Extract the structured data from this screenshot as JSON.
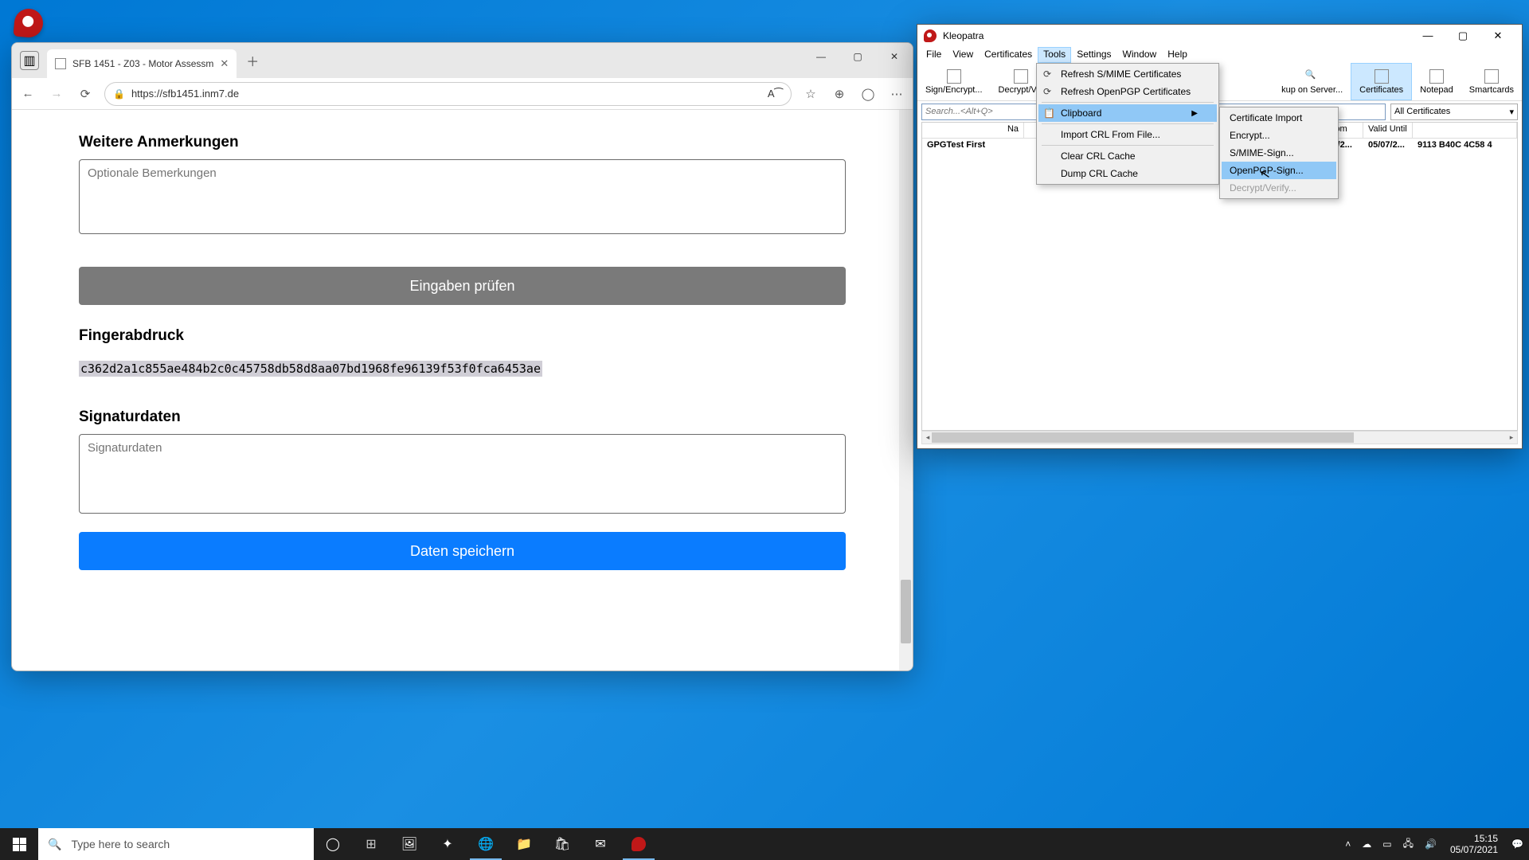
{
  "edge": {
    "tab_title": "SFB 1451 - Z03 - Motor Assessm",
    "url": "https://sfb1451.inm7.de",
    "page": {
      "remarks_heading": "Weitere Anmerkungen",
      "remarks_placeholder": "Optionale Bemerkungen",
      "check_button": "Eingaben prüfen",
      "fingerprint_heading": "Fingerabdruck",
      "fingerprint_value": "c362d2a1c855ae484b2c0c45758db58d8aa07bd1968fe96139f53f0fca6453ae",
      "sig_heading": "Signaturdaten",
      "sig_placeholder": "Signaturdaten",
      "save_button": "Daten speichern"
    }
  },
  "kleo": {
    "title": "Kleopatra",
    "menu": {
      "file": "File",
      "view": "View",
      "certs": "Certificates",
      "tools": "Tools",
      "settings": "Settings",
      "window": "Window",
      "help": "Help"
    },
    "toolbar": {
      "sign": "Sign/Encrypt...",
      "decrypt": "Decrypt/Ver",
      "lookup": "kup on Server...",
      "certs": "Certificates",
      "notepad": "Notepad",
      "smart": "Smartcards"
    },
    "search_placeholder": "Search...<Alt+Q>",
    "filter": "All Certificates",
    "columns": {
      "name": "Na",
      "validfrom": "lid From",
      "validuntil": "Valid Until"
    },
    "row": {
      "name": "GPGTest First",
      "validfrom": "05/07/2...",
      "validuntil": "05/07/2...",
      "keyid": "9113 B40C 4C58 4"
    },
    "tools_menu": {
      "refresh_smime": "Refresh S/MIME Certificates",
      "refresh_pgp": "Refresh OpenPGP Certificates",
      "clipboard": "Clipboard",
      "import_crl": "Import CRL From File...",
      "clear_crl": "Clear CRL Cache",
      "dump_crl": "Dump CRL Cache"
    },
    "clipboard_menu": {
      "cert_import": "Certificate Import",
      "encrypt": "Encrypt...",
      "smime_sign": "S/MIME-Sign...",
      "pgp_sign": "OpenPGP-Sign...",
      "decrypt": "Decrypt/Verify..."
    }
  },
  "taskbar": {
    "search": "Type here to search",
    "time": "15:15",
    "date": "05/07/2021"
  }
}
